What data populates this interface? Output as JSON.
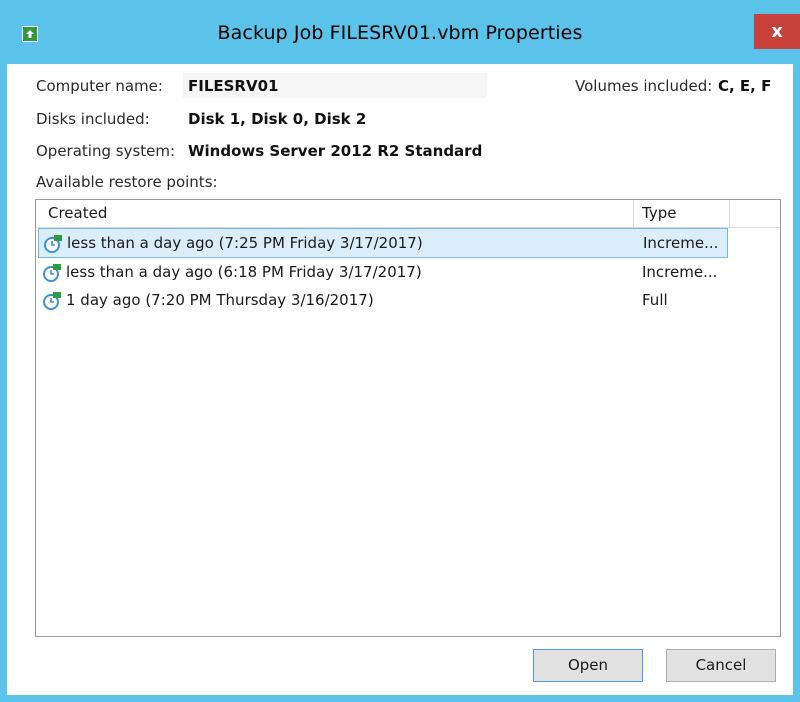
{
  "window": {
    "title": "Backup Job FILESRV01.vbm Properties",
    "close_glyph": "x"
  },
  "info": {
    "computer_label": "Computer name:",
    "computer_value": "FILESRV01",
    "volumes_label": "Volumes included:",
    "volumes_value": "C, E, F",
    "disks_label": "Disks included:",
    "disks_value": "Disk 1, Disk 0, Disk 2",
    "os_label": "Operating system:",
    "os_value": "Windows Server 2012 R2 Standard",
    "restore_label": "Available restore points:"
  },
  "table": {
    "columns": [
      "Created",
      "Type"
    ],
    "rows": [
      {
        "created": "less than a day ago (7:25 PM Friday 3/17/2017)",
        "type": "Increme...",
        "icon": "restore-point-icon",
        "selected": true
      },
      {
        "created": "less than a day ago (6:18 PM Friday 3/17/2017)",
        "type": "Increme...",
        "icon": "restore-point-icon",
        "selected": false
      },
      {
        "created": "1 day ago (7:20 PM Thursday 3/16/2017)",
        "type": "Full",
        "icon": "restore-point-icon",
        "selected": false
      }
    ]
  },
  "buttons": {
    "open": "Open",
    "cancel": "Cancel"
  },
  "colors": {
    "titlebar": "#5bc2e9",
    "close": "#c8413a",
    "selection": "#dcedfa",
    "selection_border": "#79b6e3"
  }
}
